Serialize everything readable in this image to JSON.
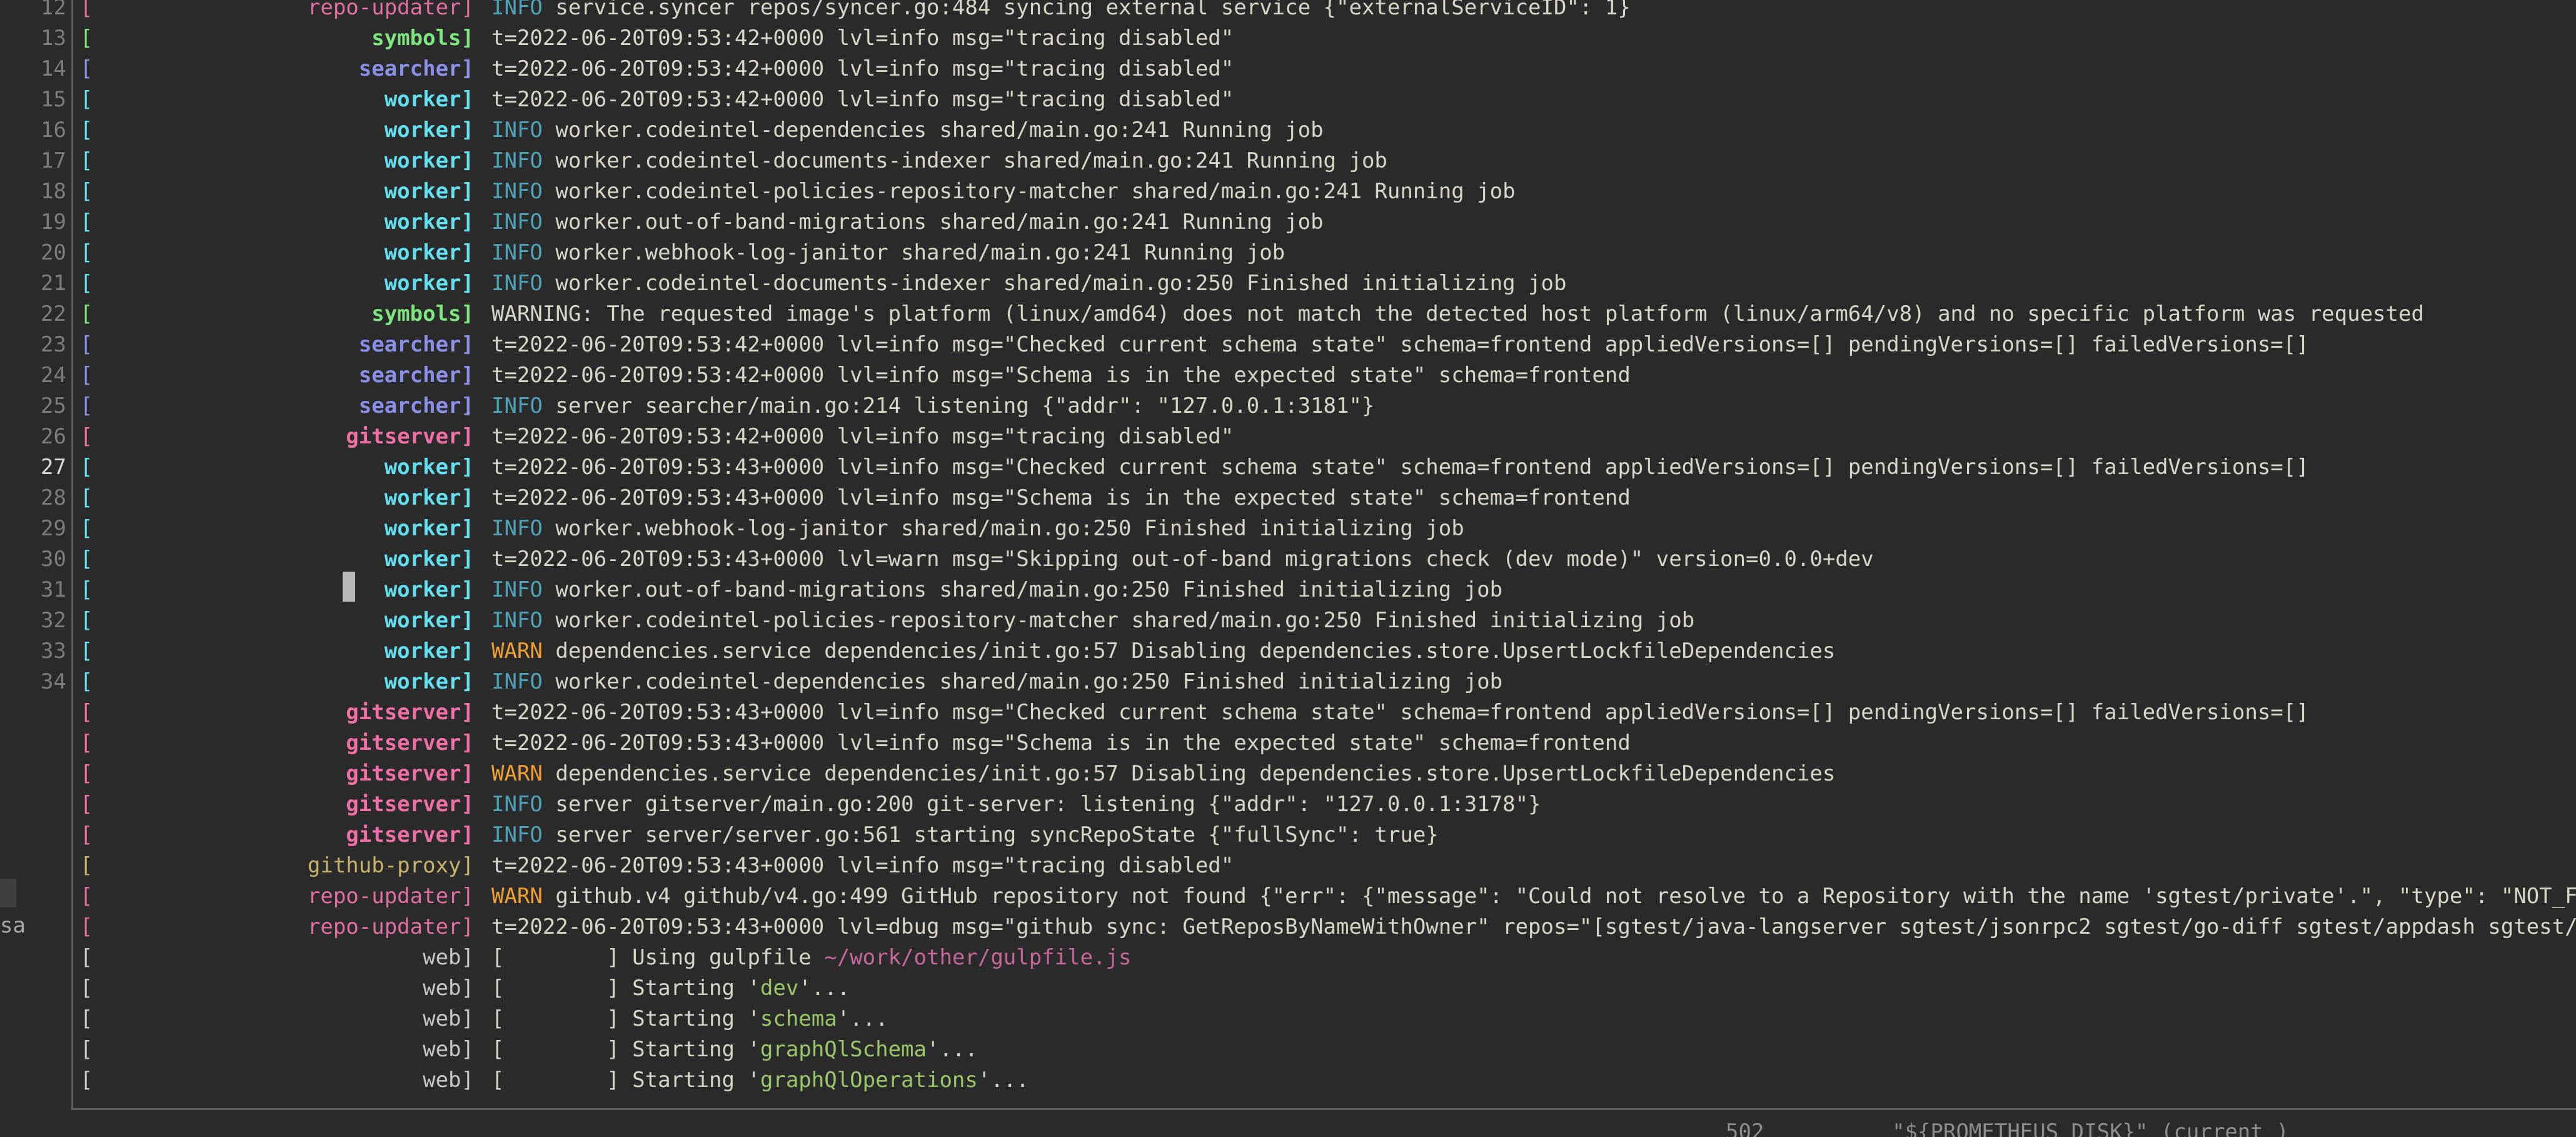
{
  "colors": {
    "background": "#2a2a2b",
    "foreground": "#d8d6c9",
    "line_number": "#7c7c7c",
    "info": "#4fa3b9",
    "warn": "#f0a030",
    "path": "#c7679a",
    "string": "#9ac76a",
    "repo-updater": "#e06fa0",
    "symbols": "#7ee57e",
    "searcher": "#8b8fe8",
    "worker": "#62e0f0",
    "gitserver": "#f06fa5",
    "github-proxy": "#c8b36a",
    "web": "#c7c7c7"
  },
  "line_numbers": [
    "12",
    "13",
    "14",
    "15",
    "16",
    "17",
    "18",
    "19",
    "20",
    "21",
    "22",
    "23",
    "24",
    "25",
    "26",
    "27",
    "28",
    "29",
    "30",
    "31",
    "32",
    "33",
    "34"
  ],
  "current_line": "27",
  "left_strip_text": "sa",
  "status_fragment": "502          \"${PROMETHEUS_DISK}\" (current_)",
  "log_rows": [
    {
      "svc": "repo-updater",
      "parts": [
        {
          "t": "INFO",
          "c": "info"
        },
        {
          "t": " service.syncer repos/syncer.go:484 syncing external service {\"externalServiceID\": 1}"
        }
      ]
    },
    {
      "svc": "symbols",
      "parts": [
        {
          "t": "t=2022-06-20T09:53:42+0000 lvl=info msg=\"tracing disabled\""
        }
      ]
    },
    {
      "svc": "searcher",
      "parts": [
        {
          "t": "t=2022-06-20T09:53:42+0000 lvl=info msg=\"tracing disabled\""
        }
      ]
    },
    {
      "svc": "worker",
      "parts": [
        {
          "t": "t=2022-06-20T09:53:42+0000 lvl=info msg=\"tracing disabled\""
        }
      ]
    },
    {
      "svc": "worker",
      "parts": [
        {
          "t": "INFO",
          "c": "info"
        },
        {
          "t": " worker.codeintel-dependencies shared/main.go:241 Running job"
        }
      ]
    },
    {
      "svc": "worker",
      "parts": [
        {
          "t": "INFO",
          "c": "info"
        },
        {
          "t": " worker.codeintel-documents-indexer shared/main.go:241 Running job"
        }
      ]
    },
    {
      "svc": "worker",
      "parts": [
        {
          "t": "INFO",
          "c": "info"
        },
        {
          "t": " worker.codeintel-policies-repository-matcher shared/main.go:241 Running job"
        }
      ]
    },
    {
      "svc": "worker",
      "parts": [
        {
          "t": "INFO",
          "c": "info"
        },
        {
          "t": " worker.out-of-band-migrations shared/main.go:241 Running job"
        }
      ]
    },
    {
      "svc": "worker",
      "parts": [
        {
          "t": "INFO",
          "c": "info"
        },
        {
          "t": " worker.webhook-log-janitor shared/main.go:241 Running job"
        }
      ]
    },
    {
      "svc": "worker",
      "parts": [
        {
          "t": "INFO",
          "c": "info"
        },
        {
          "t": " worker.codeintel-documents-indexer shared/main.go:250 Finished initializing job"
        }
      ]
    },
    {
      "svc": "symbols",
      "parts": [
        {
          "t": "WARNING: The requested image's platform (linux/amd64) does not match the detected host platform (linux/arm64/v8) and no specific platform was requested"
        }
      ]
    },
    {
      "svc": "searcher",
      "parts": [
        {
          "t": "t=2022-06-20T09:53:42+0000 lvl=info msg=\"Checked current schema state\" schema=frontend appliedVersions=[] pendingVersions=[] failedVersions=[]"
        }
      ]
    },
    {
      "svc": "searcher",
      "parts": [
        {
          "t": "t=2022-06-20T09:53:42+0000 lvl=info msg=\"Schema is in the expected state\" schema=frontend"
        }
      ]
    },
    {
      "svc": "searcher",
      "parts": [
        {
          "t": "INFO",
          "c": "info"
        },
        {
          "t": " server searcher/main.go:214 listening {\"addr\": \"127.0.0.1:3181\"}"
        }
      ]
    },
    {
      "svc": "gitserver",
      "parts": [
        {
          "t": "t=2022-06-20T09:53:42+0000 lvl=info msg=\"tracing disabled\""
        }
      ]
    },
    {
      "svc": "worker",
      "parts": [
        {
          "t": "t=2022-06-20T09:53:43+0000 lvl=info msg=\"Checked current schema state\" schema=frontend appliedVersions=[] pendingVersions=[] failedVersions=[]"
        }
      ]
    },
    {
      "svc": "worker",
      "parts": [
        {
          "t": "t=2022-06-20T09:53:43+0000 lvl=info msg=\"Schema is in the expected state\" schema=frontend"
        }
      ]
    },
    {
      "svc": "worker",
      "parts": [
        {
          "t": "INFO",
          "c": "info"
        },
        {
          "t": " worker.webhook-log-janitor shared/main.go:250 Finished initializing job"
        }
      ]
    },
    {
      "svc": "worker",
      "parts": [
        {
          "t": "t=2022-06-20T09:53:43+0000 lvl=warn msg=\"Skipping out-of-band migrations check (dev mode)\" version=0.0.0+dev"
        }
      ]
    },
    {
      "svc": "worker",
      "parts": [
        {
          "t": "INFO",
          "c": "info"
        },
        {
          "t": " worker.out-of-band-migrations shared/main.go:250 Finished initializing job"
        }
      ]
    },
    {
      "svc": "worker",
      "parts": [
        {
          "t": "INFO",
          "c": "info"
        },
        {
          "t": " worker.codeintel-policies-repository-matcher shared/main.go:250 Finished initializing job"
        }
      ]
    },
    {
      "svc": "worker",
      "parts": [
        {
          "t": "WARN",
          "c": "warn"
        },
        {
          "t": " dependencies.service dependencies/init.go:57 Disabling dependencies.store.UpsertLockfileDependencies"
        }
      ]
    },
    {
      "svc": "worker",
      "parts": [
        {
          "t": "INFO",
          "c": "info"
        },
        {
          "t": " worker.codeintel-dependencies shared/main.go:250 Finished initializing job"
        }
      ]
    },
    {
      "svc": "gitserver",
      "parts": [
        {
          "t": "t=2022-06-20T09:53:43+0000 lvl=info msg=\"Checked current schema state\" schema=frontend appliedVersions=[] pendingVersions=[] failedVersions=[]"
        }
      ]
    },
    {
      "svc": "gitserver",
      "parts": [
        {
          "t": "t=2022-06-20T09:53:43+0000 lvl=info msg=\"Schema is in the expected state\" schema=frontend"
        }
      ]
    },
    {
      "svc": "gitserver",
      "parts": [
        {
          "t": "WARN",
          "c": "warn"
        },
        {
          "t": " dependencies.service dependencies/init.go:57 Disabling dependencies.store.UpsertLockfileDependencies"
        }
      ]
    },
    {
      "svc": "gitserver",
      "parts": [
        {
          "t": "INFO",
          "c": "info"
        },
        {
          "t": " server gitserver/main.go:200 git-server: listening {\"addr\": \"127.0.0.1:3178\"}"
        }
      ]
    },
    {
      "svc": "gitserver",
      "parts": [
        {
          "t": "INFO",
          "c": "info"
        },
        {
          "t": " server server/server.go:561 starting syncRepoState {\"fullSync\": true}"
        }
      ]
    },
    {
      "svc": "github-proxy",
      "parts": [
        {
          "t": "t=2022-06-20T09:53:43+0000 lvl=info msg=\"tracing disabled\""
        }
      ]
    },
    {
      "svc": "repo-updater",
      "parts": [
        {
          "t": "WARN",
          "c": "warn"
        },
        {
          "t": " github.v4 github/v4.go:499 GitHub repository not found {\"err\": {\"message\": \"Could not resolve to a Repository with the name 'sgtest/private'.\", \"type\": \"NOT_FOUND"
        }
      ]
    },
    {
      "svc": "repo-updater",
      "parts": [
        {
          "t": "t=2022-06-20T09:53:43+0000 lvl=dbug msg=\"github sync: GetReposByNameWithOwner\" repos=\"[sgtest/java-langserver sgtest/jsonrpc2 sgtest/go-diff sgtest/appdash sgtest/sour"
        }
      ]
    },
    {
      "svc": "web",
      "parts": [
        {
          "t": "[        ] Using gulpfile "
        },
        {
          "t": "~/work/other/gulpfile.js",
          "c": "path"
        }
      ]
    },
    {
      "svc": "web",
      "parts": [
        {
          "t": "[        ] Starting '"
        },
        {
          "t": "dev",
          "c": "str"
        },
        {
          "t": "'..."
        }
      ]
    },
    {
      "svc": "web",
      "parts": [
        {
          "t": "[        ] Starting '"
        },
        {
          "t": "schema",
          "c": "str"
        },
        {
          "t": "'..."
        }
      ]
    },
    {
      "svc": "web",
      "parts": [
        {
          "t": "[        ] Starting '"
        },
        {
          "t": "graphQlSchema",
          "c": "str"
        },
        {
          "t": "'..."
        }
      ]
    },
    {
      "svc": "web",
      "parts": [
        {
          "t": "[        ] Starting '"
        },
        {
          "t": "graphQlOperations",
          "c": "str"
        },
        {
          "t": "'..."
        }
      ]
    }
  ]
}
